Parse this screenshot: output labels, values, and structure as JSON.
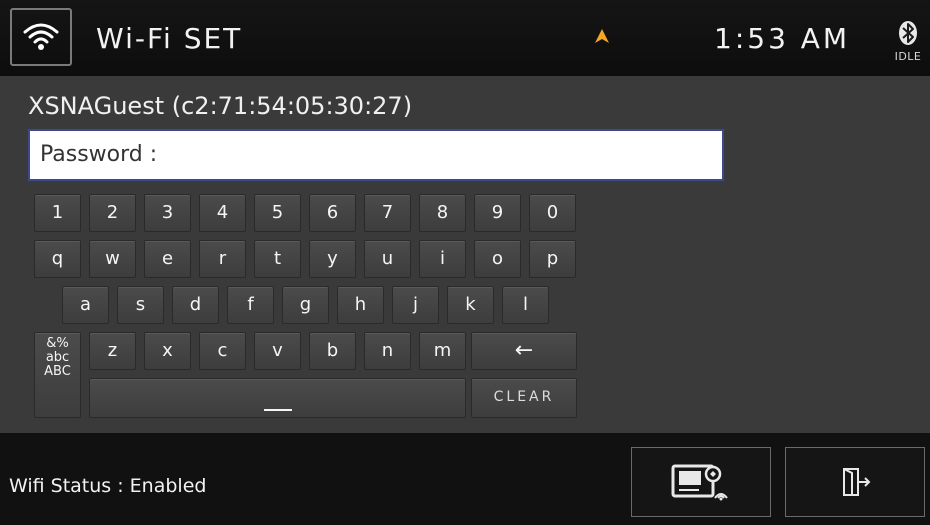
{
  "header": {
    "title": "Wi-Fi SET",
    "clock": "1:53 AM",
    "bluetooth_status": "IDLE",
    "wifi_icon": "wifi-icon",
    "nav_icon": "navigation-arrow-icon",
    "bluetooth_icon": "bluetooth-icon"
  },
  "network": {
    "name": "XSNAGuest (c2:71:54:05:30:27)"
  },
  "password": {
    "label": "Password :"
  },
  "keyboard": {
    "row1": [
      "1",
      "2",
      "3",
      "4",
      "5",
      "6",
      "7",
      "8",
      "9",
      "0"
    ],
    "row2": [
      "q",
      "w",
      "e",
      "r",
      "t",
      "y",
      "u",
      "i",
      "o",
      "p"
    ],
    "row3": [
      "a",
      "s",
      "d",
      "f",
      "g",
      "h",
      "j",
      "k",
      "l"
    ],
    "row4": [
      "z",
      "x",
      "c",
      "v",
      "b",
      "n",
      "m"
    ],
    "mode_key": [
      "&%",
      "abc",
      "ABC"
    ],
    "backspace": "←",
    "clear": "CLEAR",
    "space_icon": "space-bar-icon"
  },
  "footer": {
    "status": "Wifi Status : Enabled",
    "device_button_icon": "wifi-device-icon",
    "exit_button_icon": "exit-icon"
  },
  "colors": {
    "accent": "#f5a623",
    "field_border": "#3b4a8c",
    "background": "#3a3a3a"
  }
}
